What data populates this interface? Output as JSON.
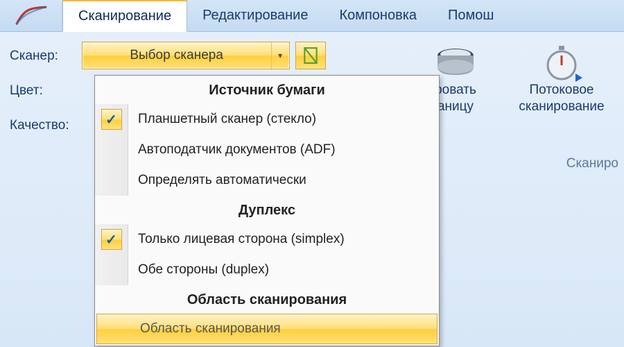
{
  "tabs": {
    "scan": "Сканирование",
    "edit": "Редактирование",
    "layout": "Компоновка",
    "help": "Помош"
  },
  "ribbon": {
    "scanner_label": "Сканер:",
    "color_label": "Цвет:",
    "quality_label": "Качество:",
    "scanner_combo": "Выбор сканера",
    "scan_page_line1": "ровать",
    "scan_page_line2": "аницу",
    "stream_line1": "Потоковое",
    "stream_line2": "сканирование",
    "group_caption": "Сканиро"
  },
  "menu": {
    "section_source": "Источник бумаги",
    "source_items": [
      {
        "label": "Планшетный сканер (стекло)",
        "checked": true
      },
      {
        "label": "Автоподатчик документов (ADF)",
        "checked": false
      },
      {
        "label": "Определять автоматически",
        "checked": false
      }
    ],
    "section_duplex": "Дуплекс",
    "duplex_items": [
      {
        "label": "Только лицевая сторона (simplex)",
        "checked": true
      },
      {
        "label": "Обе стороны (duplex)",
        "checked": false
      }
    ],
    "section_area": "Область сканирования",
    "area_item_label": "Область сканирования"
  }
}
